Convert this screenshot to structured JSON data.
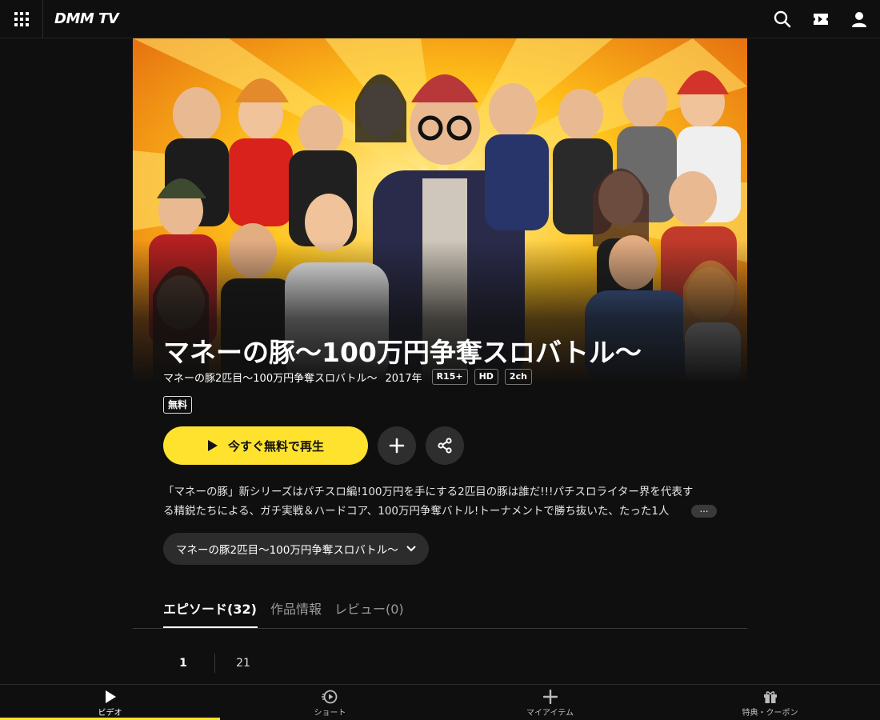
{
  "header": {
    "logo_text": "DMM TV",
    "icons": [
      "apps-grid-icon",
      "search-icon",
      "ticket-icon",
      "user-icon"
    ]
  },
  "hero": {
    "image_description_icon": "cast-group-key-visual",
    "title": "マネーの豚〜100万円争奪スロバトル〜"
  },
  "meta": {
    "series": "マネーの豚2匹目〜100万円争奪スロバトル〜",
    "year": "2017年",
    "badges": [
      "R15+",
      "HD",
      "2ch"
    ],
    "price_badge": "無料"
  },
  "actions": {
    "play_label": "今すぐ無料で再生",
    "play_color": "#ffe22e"
  },
  "description": {
    "line1": "「マネーの豚」新シリーズはパチスロ編!100万円を手にする2匹目の豚は誰だ!!!パチスロライター界を代表す",
    "line2": "る精鋭たちによる、ガチ実戦＆ハードコア、100万円争奪バトル!トーナメントで勝ち抜いた、たった1人",
    "more_label": "…"
  },
  "season_select": {
    "selected": "マネーの豚2匹目〜100万円争奪スロバトル〜"
  },
  "tabs": {
    "episodes": "エピソード(32)",
    "info": "作品情報",
    "reviews": "レビュー(0)"
  },
  "pager": {
    "current": "1",
    "next": "21"
  },
  "bottom_nav": {
    "video": "ビデオ",
    "short": "ショート",
    "my_items": "マイアイテム",
    "perks": "特典・クーポン"
  }
}
